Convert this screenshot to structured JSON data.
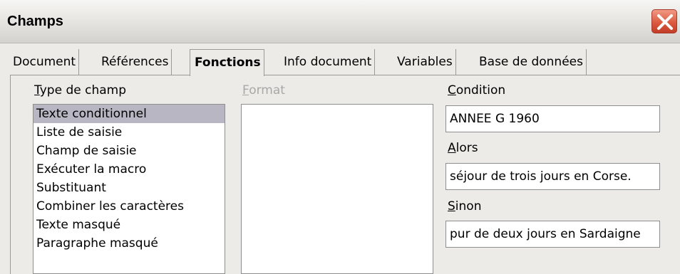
{
  "window": {
    "title": "Champs",
    "close_icon": "close-icon"
  },
  "tabs": [
    {
      "label": "Document",
      "active": false
    },
    {
      "label": "Références",
      "active": false
    },
    {
      "label": "Fonctions",
      "active": true
    },
    {
      "label": "Info document",
      "active": false
    },
    {
      "label": "Variables",
      "active": false
    },
    {
      "label": "Base de données",
      "active": false
    }
  ],
  "type_de_champ": {
    "label_mnemonic": "T",
    "label_rest": "ype de champ",
    "items": [
      "Texte conditionnel",
      "Liste de saisie",
      "Champ de saisie",
      "Exécuter la macro",
      "Substituant",
      "Combiner les caractères",
      "Texte masqué",
      "Paragraphe masqué"
    ],
    "selected": "Texte conditionnel"
  },
  "format": {
    "label_mnemonic": "F",
    "label_rest": "ormat"
  },
  "condition": {
    "label_mnemonic": "C",
    "label_rest": "ondition",
    "value": "ANNEE G 1960"
  },
  "alors": {
    "label_mnemonic": "A",
    "label_rest": "lors",
    "value": "séjour de trois jours en Corse."
  },
  "sinon": {
    "label_mnemonic": "S",
    "label_rest": "inon",
    "value": "pur de deux jours en Sardaigne"
  },
  "colors": {
    "selection": "#b8b6c2",
    "close_button": "#dc5a40"
  }
}
